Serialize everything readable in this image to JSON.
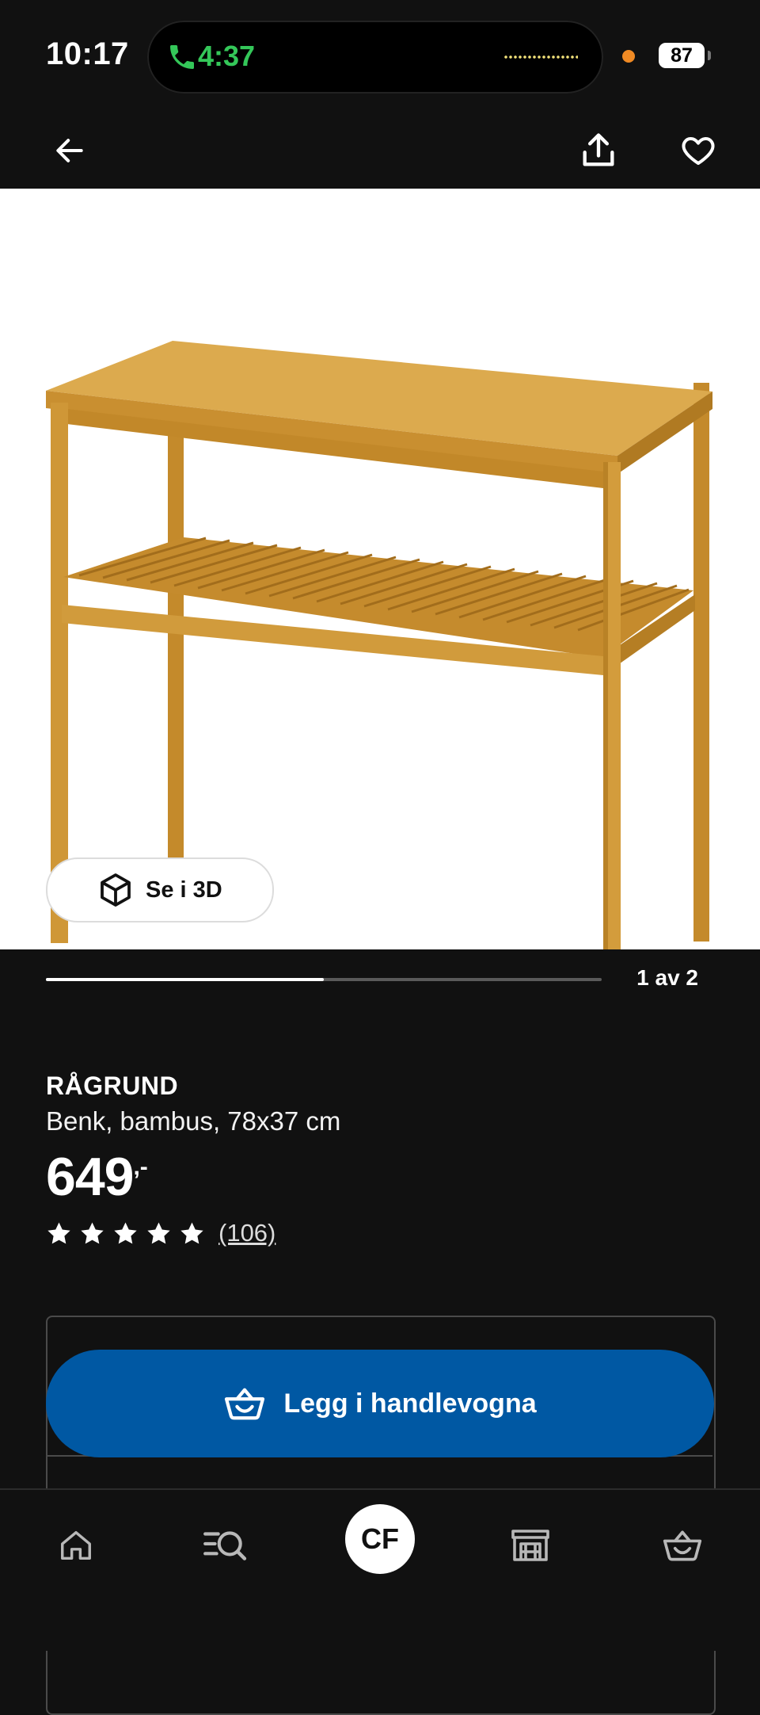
{
  "status_bar": {
    "time": "10:17",
    "call_duration": "4:37",
    "battery": "87",
    "call_icon": "phone-icon",
    "accent": "#34c759"
  },
  "top_nav": {
    "back_icon": "arrow-left-icon",
    "share_icon": "share-icon",
    "favorite_icon": "heart-icon"
  },
  "gallery": {
    "image_label": "RÅGRUND bench product image",
    "view_3d_label": "Se i 3D",
    "view_3d_icon": "cube-icon",
    "pager_text": "1 av 2",
    "progress_fraction": 0.5
  },
  "product": {
    "name": "RÅGRUND",
    "description": "Benk, bambus, 78x37 cm",
    "price": "649",
    "price_suffix": ",-",
    "rating": 5,
    "review_count": "(106)",
    "star_icon": "star-icon"
  },
  "actions": {
    "add_to_cart_label": "Legg i handlevogna",
    "add_to_cart_icon": "shopping-basket-icon",
    "button_color": "#0058a3"
  },
  "tab_bar": {
    "home_icon": "home-icon",
    "search_icon": "search-list-icon",
    "profile_initials": "CF",
    "store_icon": "store-icon",
    "cart_icon": "shopping-basket-icon"
  }
}
